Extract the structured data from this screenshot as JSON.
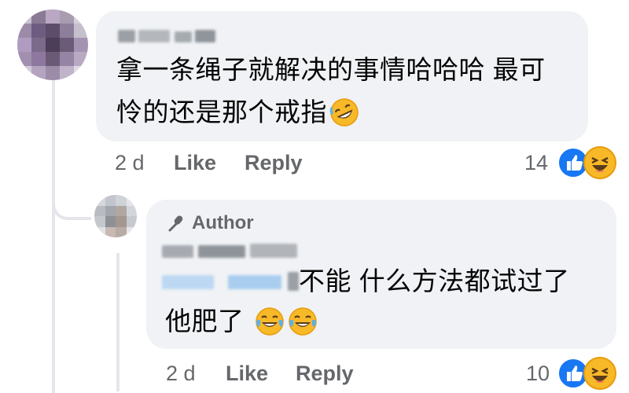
{
  "comments": [
    {
      "text_line1": "拿一条绳子就解决的事情哈哈哈 最可",
      "text_line2": "怜的还是那个戒指",
      "emoji_icon": "rolling-on-floor-laughing-icon",
      "time": "2 d",
      "like_label": "Like",
      "reply_label": "Reply",
      "reaction_count": "14",
      "reactions": [
        "like-icon",
        "haha-icon"
      ]
    }
  ],
  "reply": {
    "author_badge": "Author",
    "author_badge_icon": "microphone-icon",
    "text_line1_tail": "不能 什么方法都试过了",
    "text_line2": "他肥了",
    "emoji_icons": [
      "tears-of-joy-icon",
      "tears-of-joy-icon"
    ],
    "time": "2 d",
    "like_label": "Like",
    "reply_label": "Reply",
    "reaction_count": "10",
    "reactions": [
      "like-icon",
      "haha-icon"
    ]
  },
  "colors": {
    "bubble": "#f0f2f5",
    "meta_text": "#65676b",
    "like_blue": "#1877f2",
    "haha_yellow": "#f7b928"
  }
}
